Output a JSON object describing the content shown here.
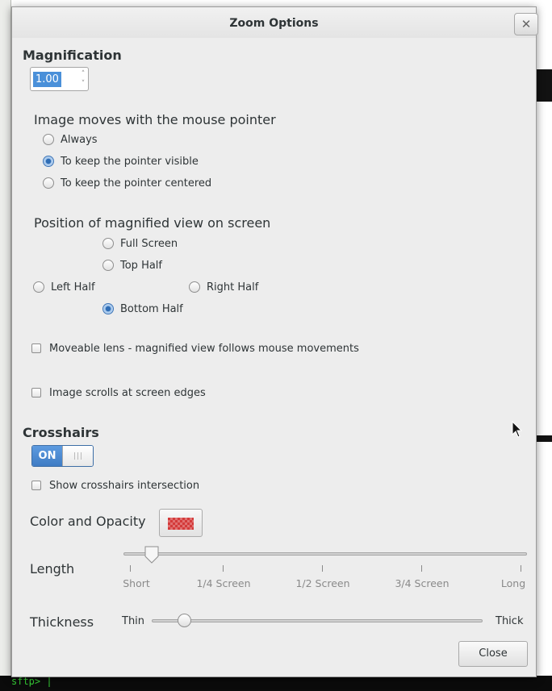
{
  "window": {
    "title": "Zoom Options",
    "close_symbol": "✕"
  },
  "magnification": {
    "heading": "Magnification",
    "value": "1.00",
    "up_arrow": "˄",
    "down_arrow": "˅"
  },
  "mouse_tracking": {
    "heading": "Image moves with the mouse pointer",
    "options": [
      {
        "label": "Always",
        "checked": false
      },
      {
        "label": "To keep the pointer visible",
        "checked": true
      },
      {
        "label": "To keep the pointer centered",
        "checked": false
      }
    ]
  },
  "screen_position": {
    "heading": "Position of magnified view on screen",
    "full_screen": "Full Screen",
    "top_half": "Top Half",
    "left_half": "Left Half",
    "right_half": "Right Half",
    "bottom_half": "Bottom Half",
    "selected": "Bottom Half"
  },
  "options": {
    "moveable_lens": "Moveable lens - magnified view follows mouse movements",
    "scroll_edges": "Image scrolls at screen edges"
  },
  "crosshairs": {
    "heading": "Crosshairs",
    "switch_label": "ON",
    "show_intersection": "Show crosshairs intersection",
    "color_label": "Color and Opacity",
    "color": "#d43a3a",
    "length_label": "Length",
    "length_marks": [
      "Short",
      "1/4 Screen",
      "1/2 Screen",
      "3/4 Screen",
      "Long"
    ],
    "length_level": 0.03,
    "thickness_label": "Thickness",
    "thin_label": "Thin",
    "thick_label": "Thick",
    "thickness_level": 0.1
  },
  "buttons": {
    "close": "Close"
  },
  "background": {
    "terminal_text": "sftp> |"
  }
}
